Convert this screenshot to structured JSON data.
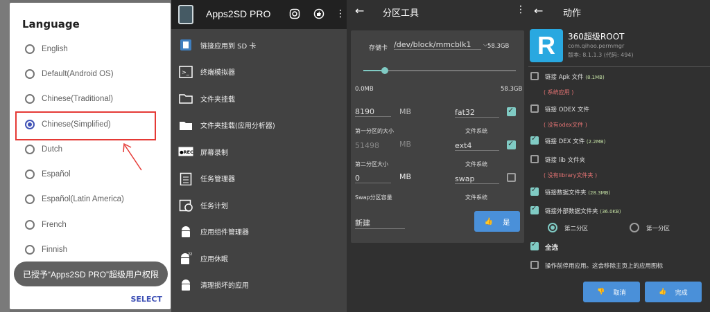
{
  "lang_dialog": {
    "title": "Language",
    "options": [
      "English",
      "Default(Android OS)",
      "Chinese(Traditional)",
      "Chinese(Simplified)",
      "Dutch",
      "Español",
      "Español(Latin America)",
      "French",
      "Finnish"
    ],
    "selected": "Chinese(Simplified)",
    "toast": "已授予“Apps2SD PRO”超级用户权限",
    "select_label": "SELECT"
  },
  "apps2sd": {
    "title": "Apps2SD PRO",
    "items": [
      {
        "label": "链接应用到 SD 卡",
        "icon": "sd-card-icon"
      },
      {
        "label": "终端模拟器",
        "icon": "terminal-icon"
      },
      {
        "label": "文件夹挂载",
        "icon": "folder-icon"
      },
      {
        "label": "文件夹挂载(应用分析器)",
        "icon": "folder-app-icon"
      },
      {
        "label": "屏幕录制",
        "icon": "rec-icon"
      },
      {
        "label": "任务管理器",
        "icon": "clipboard-icon"
      },
      {
        "label": "任务计划",
        "icon": "schedule-icon"
      },
      {
        "label": "应用组件管理器",
        "icon": "android-icon"
      },
      {
        "label": "应用休眠",
        "icon": "sleep-android-icon"
      },
      {
        "label": "清理损坏的应用",
        "icon": "clean-android-icon"
      }
    ]
  },
  "partition": {
    "title": "分区工具",
    "storage_label": "存储卡",
    "device": "/dev/block/mmcblk1",
    "device_size": "58.3GB",
    "slider_min": "0.0MB",
    "slider_max": "58.3GB",
    "slider_fraction": 0.14,
    "p1_size": "8190",
    "p1_unit": "MB",
    "p1_fs": "fat32",
    "p1_label": "第一分区的大小",
    "p1_fs_label": "文件系统",
    "p2_size": "51498",
    "p2_unit": "MB",
    "p2_fs": "ext4",
    "p2_label": "第二分区大小",
    "p2_fs_label": "文件系统",
    "swap_size": "0",
    "swap_unit": "MB",
    "swap_fs": "swap",
    "swap_label": "Swap分区容量",
    "swap_fs_label": "文件系统",
    "mode": "新建",
    "ok_label": "是"
  },
  "actions": {
    "title": "动作",
    "app_name": "360超级ROOT",
    "package": "com.qihoo.permmgr",
    "version": "版本: 8.1.1.3 (代码: 494)",
    "rows": [
      {
        "label": "链接 Apk 文件",
        "size": "(8.1MB)",
        "checked": false
      },
      {
        "label": "链接 ODEX 文件",
        "size": "",
        "checked": false
      },
      {
        "label": "链接 DEX 文件",
        "size": "(2.2MB)",
        "checked": true
      },
      {
        "label": "链接 lib 文件夹",
        "size": "",
        "checked": false
      },
      {
        "label": "链接数据文件夹",
        "size": "(28.3MB)",
        "checked": true
      },
      {
        "label": "链接外部数据文件夹",
        "size": "(36.0KB)",
        "checked": true
      }
    ],
    "notes": [
      "( 系统应用 )",
      "( 没有odex文件 )",
      "( 没有library文件夹 )"
    ],
    "radio_second": "第二分区",
    "radio_first": "第一分区",
    "select_all": "全选",
    "disable_note": "操作前停用应用。这会移除主页上的应用图标",
    "cancel_label": "取消",
    "done_label": "完成"
  }
}
